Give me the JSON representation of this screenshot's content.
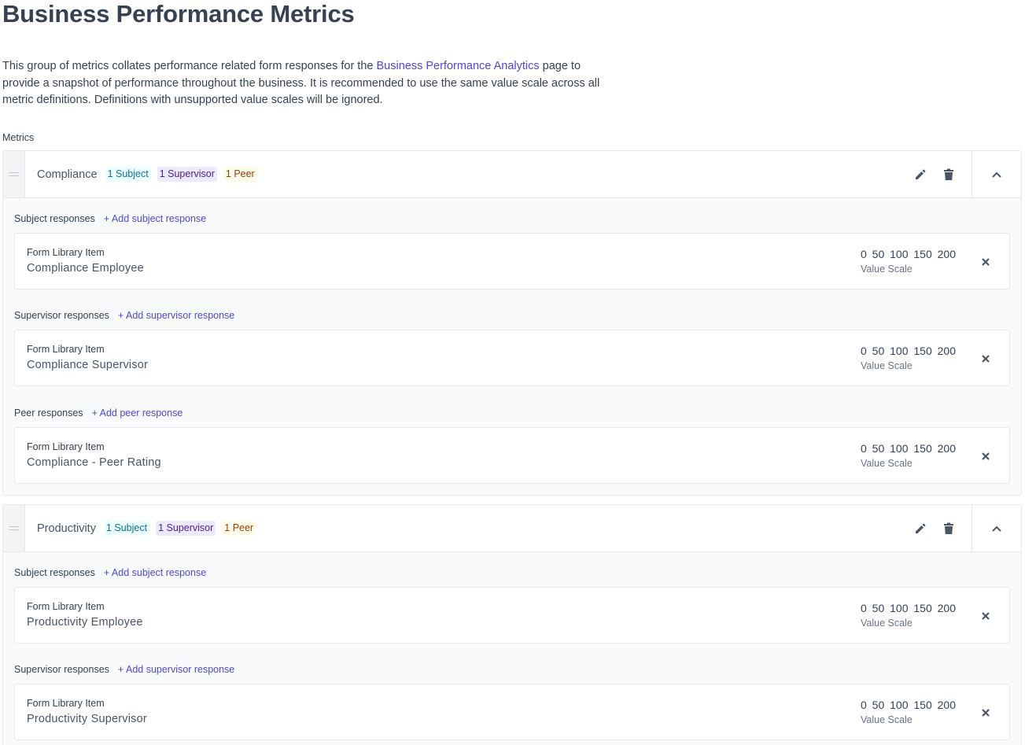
{
  "page": {
    "title": "Business Performance Metrics",
    "description_before": "This group of metrics collates performance related form responses for the ",
    "description_link": "Business Performance Analytics",
    "description_after": " page to provide a snapshot of performance throughout the business. It is recommended to use the same value scale across all metric definitions. Definitions with unsupported value scales will be ignored.",
    "metrics_label": "Metrics"
  },
  "icons": {
    "drag": "drag-handle-icon",
    "edit": "pencil-icon",
    "delete": "trash-icon",
    "collapse": "chevron-up-icon",
    "remove": "close-icon"
  },
  "metrics": [
    {
      "name": "Compliance",
      "badges": {
        "subject": "1 Subject",
        "supervisor": "1 Supervisor",
        "peer": "1 Peer"
      },
      "groups": [
        {
          "title": "Subject responses",
          "add": "+ Add subject response",
          "item": {
            "label": "Form Library Item",
            "value": "Compliance Employee",
            "scale": "0 50 100 150 200",
            "scale_label": "Value Scale"
          }
        },
        {
          "title": "Supervisor responses",
          "add": "+ Add supervisor response",
          "item": {
            "label": "Form Library Item",
            "value": "Compliance Supervisor",
            "scale": "0 50 100 150 200",
            "scale_label": "Value Scale"
          }
        },
        {
          "title": "Peer responses",
          "add": "+ Add peer response",
          "item": {
            "label": "Form Library Item",
            "value": "Compliance - Peer Rating",
            "scale": "0 50 100 150 200",
            "scale_label": "Value Scale"
          }
        }
      ]
    },
    {
      "name": "Productivity",
      "badges": {
        "subject": "1 Subject",
        "supervisor": "1 Supervisor",
        "peer": "1 Peer"
      },
      "groups": [
        {
          "title": "Subject responses",
          "add": "+ Add subject response",
          "item": {
            "label": "Form Library Item",
            "value": "Productivity Employee",
            "scale": "0 50 100 150 200",
            "scale_label": "Value Scale"
          }
        },
        {
          "title": "Supervisor responses",
          "add": "+ Add supervisor response",
          "item": {
            "label": "Form Library Item",
            "value": "Productivity Supervisor",
            "scale": "0 50 100 150 200",
            "scale_label": "Value Scale"
          }
        }
      ]
    }
  ]
}
